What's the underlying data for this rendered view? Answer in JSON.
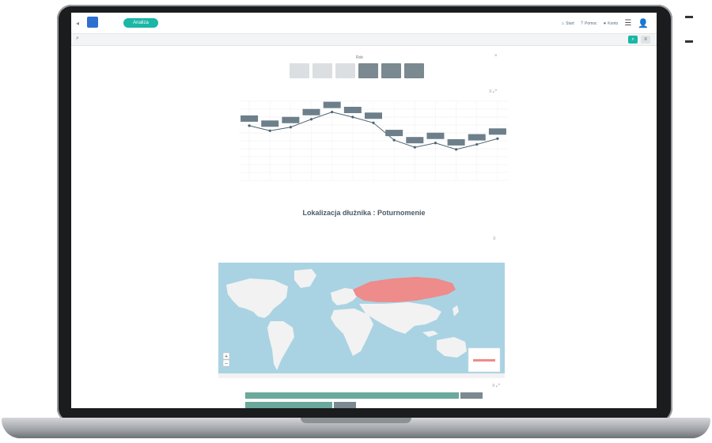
{
  "top_bar": {
    "logo_text": "",
    "mode_label": "Analiza",
    "links": [
      {
        "icon": "home-icon",
        "label": "Start"
      },
      {
        "icon": "help-icon",
        "label": "Pomoc"
      },
      {
        "icon": "account-icon",
        "label": "Konto"
      }
    ]
  },
  "search": {
    "placeholder": "",
    "breadcrumb": ""
  },
  "years": {
    "label": "Rok",
    "items": [
      "",
      "",
      "",
      "",
      "",
      ""
    ],
    "selected": [
      3,
      4,
      5
    ]
  },
  "line_chart": {
    "title": "",
    "tools": "≡ ⤢"
  },
  "chart_data": {
    "type": "line",
    "categories": [
      "1",
      "2",
      "3",
      "4",
      "5",
      "6",
      "7",
      "8",
      "9",
      "10",
      "11",
      "12",
      "13"
    ],
    "values": [
      760,
      690,
      740,
      850,
      950,
      880,
      800,
      560,
      460,
      520,
      430,
      500,
      580
    ],
    "ylim": [
      0,
      1100
    ],
    "yticks": [
      "",
      "",
      "",
      "",
      "",
      "",
      "",
      "",
      "",
      "",
      ""
    ],
    "xticks": [
      "",
      "",
      "",
      "",
      "",
      "",
      "",
      "",
      "",
      "",
      "",
      "",
      ""
    ],
    "data_labels": [
      "",
      "",
      "",
      "",
      "",
      "",
      "",
      "",
      "",
      "",
      "",
      "",
      ""
    ],
    "series_color": "#4d6472",
    "label_color": "#6d7f8a",
    "grid": true
  },
  "section": {
    "title": "Lokalizacja dłużnika : Poturnomenie"
  },
  "map": {
    "title": "",
    "tools": "≡",
    "ocean_color": "#a9d3e3",
    "land_color": "#f2f2f2",
    "highlight_color": "#ee8b8b",
    "highlighted_region": "Russia",
    "zoom_in": "+",
    "zoom_out": "−",
    "legend_label": ""
  },
  "bars": {
    "title": "",
    "tools": "≡ ⤢",
    "row_label": "",
    "rows": [
      {
        "fraction": 0.93,
        "value_label": ""
      },
      {
        "fraction": 0.38,
        "value_label": ""
      }
    ],
    "bar_color": "#6aa99c"
  }
}
